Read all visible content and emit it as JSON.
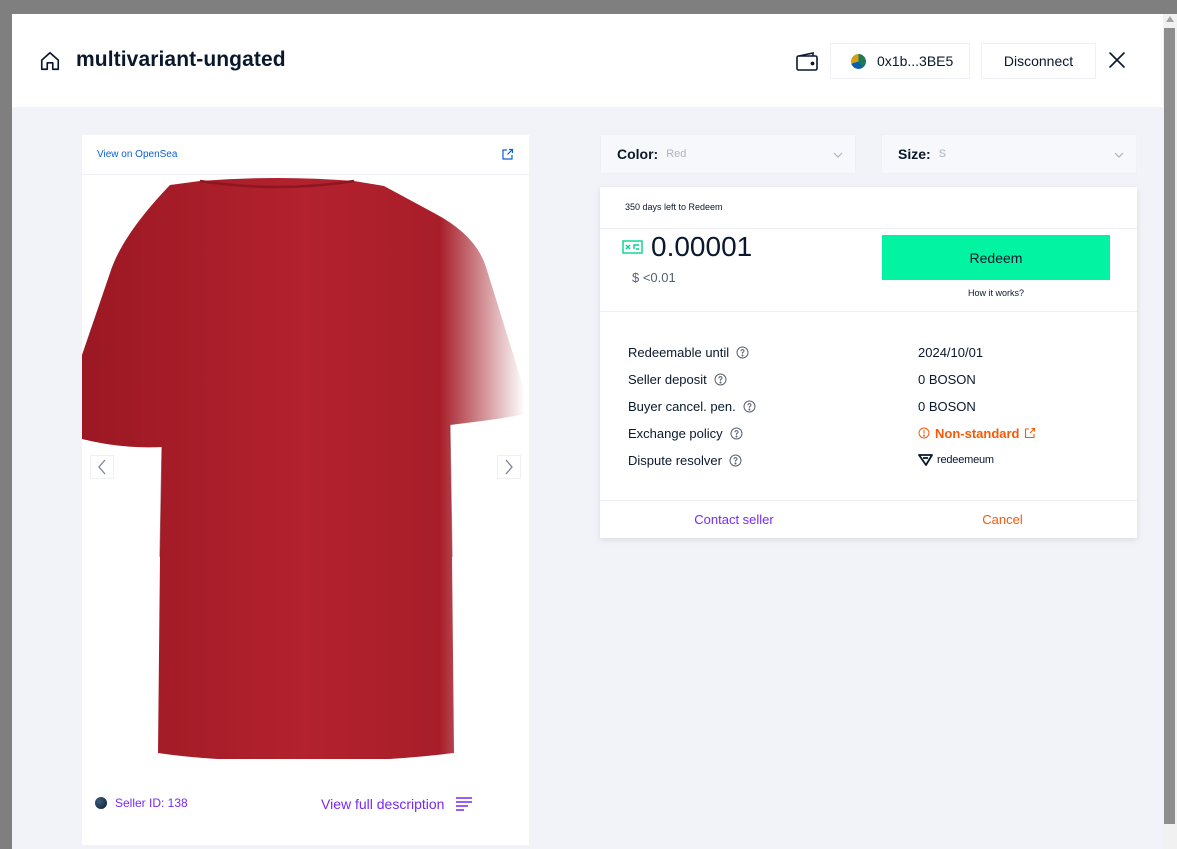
{
  "header": {
    "title": "multivariant-ungated",
    "address": "0x1b...3BE5",
    "disconnect_label": "Disconnect"
  },
  "product_card": {
    "opensea_label": "View on OpenSea",
    "seller_label": "Seller ID: 138",
    "full_description_label": "View full description",
    "image": {
      "subject": "red t-shirt (back view)",
      "shirt_color": "#b0202c"
    }
  },
  "variants": {
    "color": {
      "label": "Color:",
      "value": "Red"
    },
    "size": {
      "label": "Size:",
      "value": "S"
    }
  },
  "redeem_panel": {
    "days_left": "350 days left to Redeem",
    "price": "0.00001",
    "price_usd": "$ <0.01",
    "redeem_label": "Redeem",
    "how_it_works": "How it works?",
    "details": [
      {
        "label": "Redeemable until",
        "value": "2024/10/01"
      },
      {
        "label": "Seller deposit",
        "value": "0 BOSON"
      },
      {
        "label": "Buyer cancel. pen.",
        "value": "0 BOSON"
      },
      {
        "label": "Exchange policy",
        "value": "Non-standard"
      },
      {
        "label": "Dispute resolver",
        "value": "redeemeum"
      }
    ],
    "contact_seller": "Contact seller",
    "cancel": "Cancel"
  },
  "colors": {
    "accent_green": "#02f3a2",
    "accent_purple": "#7829f6",
    "warning_orange": "#f35b0a",
    "link_blue": "#0b5fd7",
    "text_dark": "#09182c"
  },
  "icons": [
    "home-icon",
    "wallet-icon",
    "avatar-dot",
    "close-icon",
    "external-link-icon",
    "chevron-left-icon",
    "chevron-right-icon",
    "chevron-down-icon",
    "boson-token-icon",
    "help-circle-icon",
    "warning-circle-icon",
    "redeemeum-logo-icon",
    "text-lines-icon"
  ]
}
